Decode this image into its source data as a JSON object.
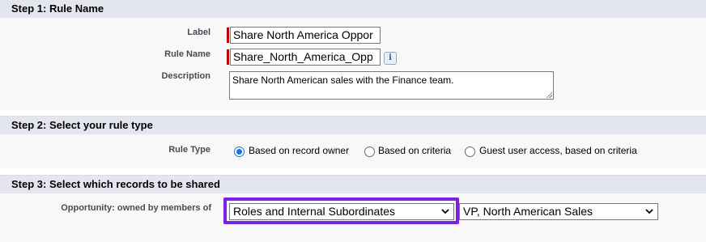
{
  "step1": {
    "header": "Step 1: Rule Name",
    "label_label": "Label",
    "label_value": "Share North America Oppor",
    "rule_name_label": "Rule Name",
    "rule_name_value": "Share_North_America_Opp",
    "description_label": "Description",
    "description_value": "Share North American sales with the Finance team.",
    "info_icon": "info-icon"
  },
  "step2": {
    "header": "Step 2: Select your rule type",
    "rule_type_label": "Rule Type",
    "options": [
      {
        "label": "Based on record owner",
        "checked": true
      },
      {
        "label": "Based on criteria",
        "checked": false
      },
      {
        "label": "Guest user access, based on criteria",
        "checked": false
      }
    ]
  },
  "step3": {
    "header": "Step 3: Select which records to be shared",
    "owned_by_label": "Opportunity: owned by members of",
    "group_type_value": "Roles and Internal Subordinates",
    "group_value": "VP, North American Sales",
    "highlight_color": "#7b22e0"
  },
  "colors": {
    "section_header_bg": "#e3e6ee",
    "required_bar": "#c00000",
    "radio_accent": "#1a73e8"
  }
}
